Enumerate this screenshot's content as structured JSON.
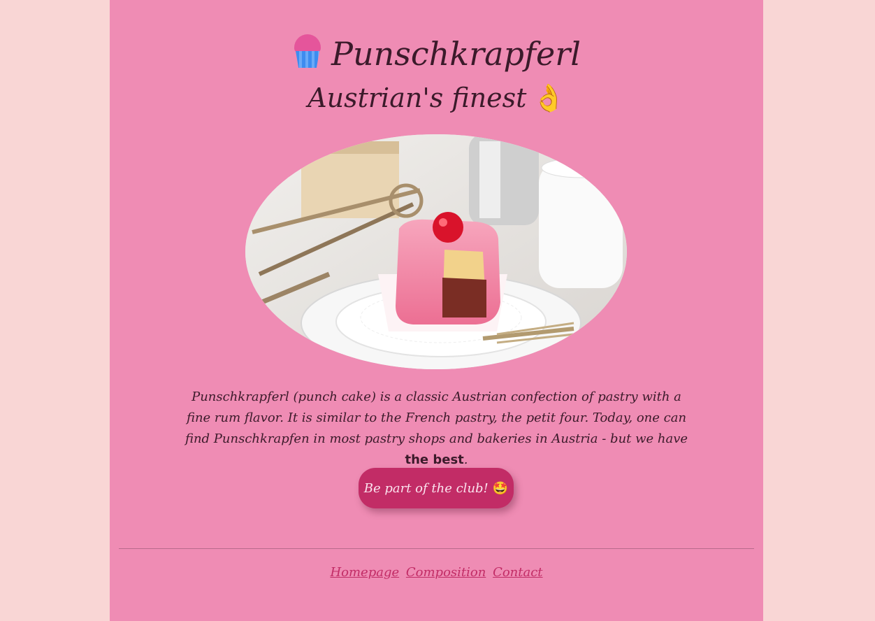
{
  "header": {
    "icon": "cupcake-icon",
    "title": "Punschkrapferl",
    "subtitle": "Austrian's finest",
    "subtitle_emoji": "👌"
  },
  "hero_image": {
    "alt": "Pink Punschkrapferl with a red cherry on a plate"
  },
  "description": {
    "text_before": "Punschkrapferl (punch cake) is a classic Austrian confection of pastry with a fine rum flavor. It is similar to the French pastry, the petit four. Today, one can find Punschkrapfen in most pastry shops and bakeries in Austria - but we have ",
    "bold": "the best",
    "text_after": "."
  },
  "cta": {
    "label": "Be part of the club!",
    "emoji": "🤩"
  },
  "footer": {
    "links": [
      "Homepage",
      "Composition",
      "Contact"
    ]
  },
  "colors": {
    "page_background": "#f9d6d5",
    "content_background": "#ef8cb4",
    "button": "#c22c66",
    "text": "#3b1a2a",
    "link": "#c22c66"
  }
}
